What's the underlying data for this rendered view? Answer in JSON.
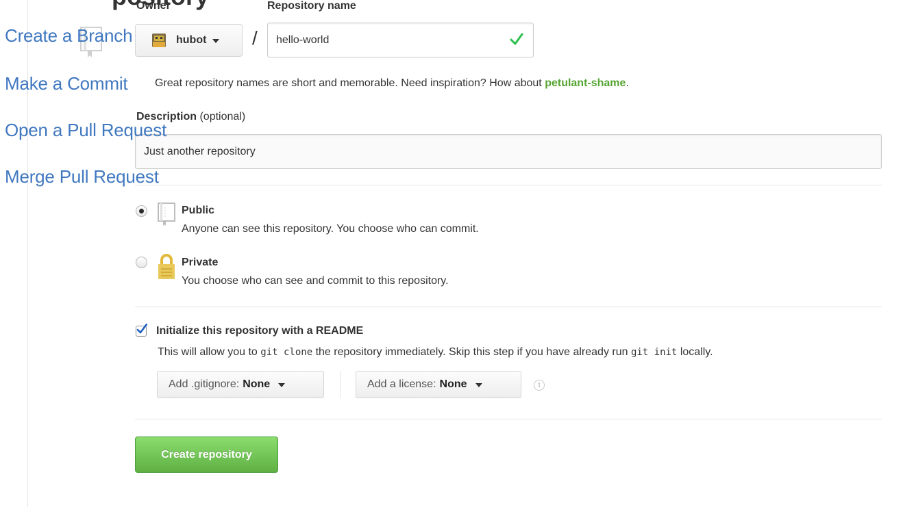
{
  "page": {
    "title_tail": "pository"
  },
  "nav": {
    "items": [
      {
        "label": "Create a Branch"
      },
      {
        "label": "Make a Commit"
      },
      {
        "label": "Open a Pull Request"
      },
      {
        "label": "Merge Pull Request"
      }
    ]
  },
  "form": {
    "owner_label": "Owner",
    "repo_label": "Repository name",
    "owner_value": "hubot",
    "slash": "/",
    "repo_value": "hello-world",
    "hint_prefix": "Great repository names are short and memorable. Need inspiration? How about ",
    "hint_suggestion": "petulant-shame",
    "hint_suffix": ".",
    "desc_label": "Description",
    "desc_optional": " (optional)",
    "desc_value": "Just another repository",
    "visibility": {
      "selected": "public",
      "public_title": "Public",
      "public_desc": "Anyone can see this repository. You choose who can commit.",
      "private_title": "Private",
      "private_desc": "You choose who can see and commit to this repository."
    },
    "init": {
      "checked": true,
      "title": "Initialize this repository with a README",
      "desc_1": "This will allow you to ",
      "code_1": "git clone",
      "desc_2": " the repository immediately. Skip this step if you have already run ",
      "code_2": "git init",
      "desc_3": " locally."
    },
    "gitignore_label": "Add .gitignore:",
    "gitignore_value": "None",
    "license_label": "Add a license:",
    "license_value": "None",
    "info_glyph": "i",
    "submit_label": "Create repository"
  },
  "colors": {
    "accent_link": "#4078c0",
    "suggestion": "#55a532",
    "button_green": "#60b044",
    "check_green": "#2cbe4e",
    "lock_gold": "#e2b93b"
  },
  "icons": [
    "repo-icon",
    "caret-down-icon",
    "checkmark-icon",
    "radio-icon",
    "lock-icon",
    "checkbox-icon",
    "info-icon"
  ]
}
